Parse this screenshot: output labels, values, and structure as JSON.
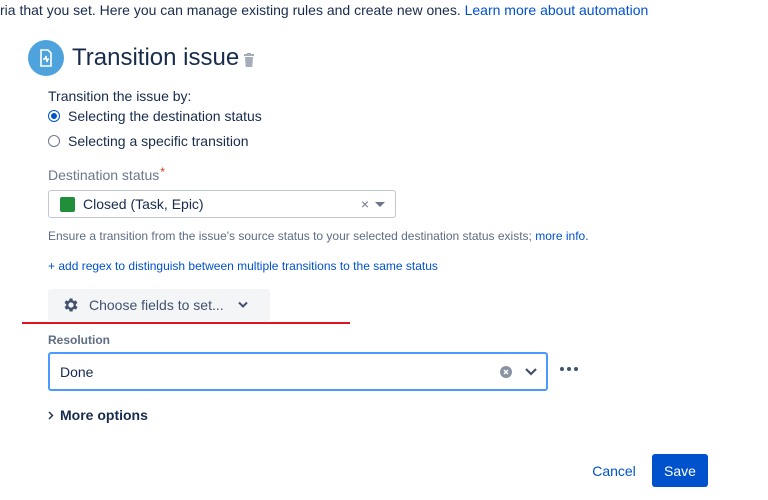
{
  "intro": {
    "text": "ria that you set. Here you can manage existing rules and create new ones. ",
    "link": "Learn more about automation"
  },
  "header": {
    "title": "Transition issue",
    "icon": "transition-icon",
    "delete_icon": "trash-icon"
  },
  "transition_by": {
    "label": "Transition the issue by:",
    "options": [
      {
        "label": "Selecting the destination status",
        "checked": true
      },
      {
        "label": "Selecting a specific transition",
        "checked": false
      }
    ]
  },
  "destination": {
    "label": "Destination status",
    "required_mark": "*",
    "value": "Closed (Task, Epic)",
    "status_color": "#1f8f3a",
    "clear": "×"
  },
  "hint": {
    "text": "Ensure a transition from the issue's source status to your selected destination status exists; ",
    "link": "more info."
  },
  "regex_link": "+ add regex to distinguish between multiple transitions to the same status",
  "choose_fields": {
    "label": "Choose fields to set..."
  },
  "resolution": {
    "label": "Resolution",
    "value": "Done"
  },
  "more_options": {
    "label": "More options"
  },
  "actions": {
    "cancel": "Cancel",
    "save": "Save"
  },
  "colors": {
    "accent": "#0052cc",
    "annotation": "#e0141e",
    "focus": "#4c9aff"
  }
}
